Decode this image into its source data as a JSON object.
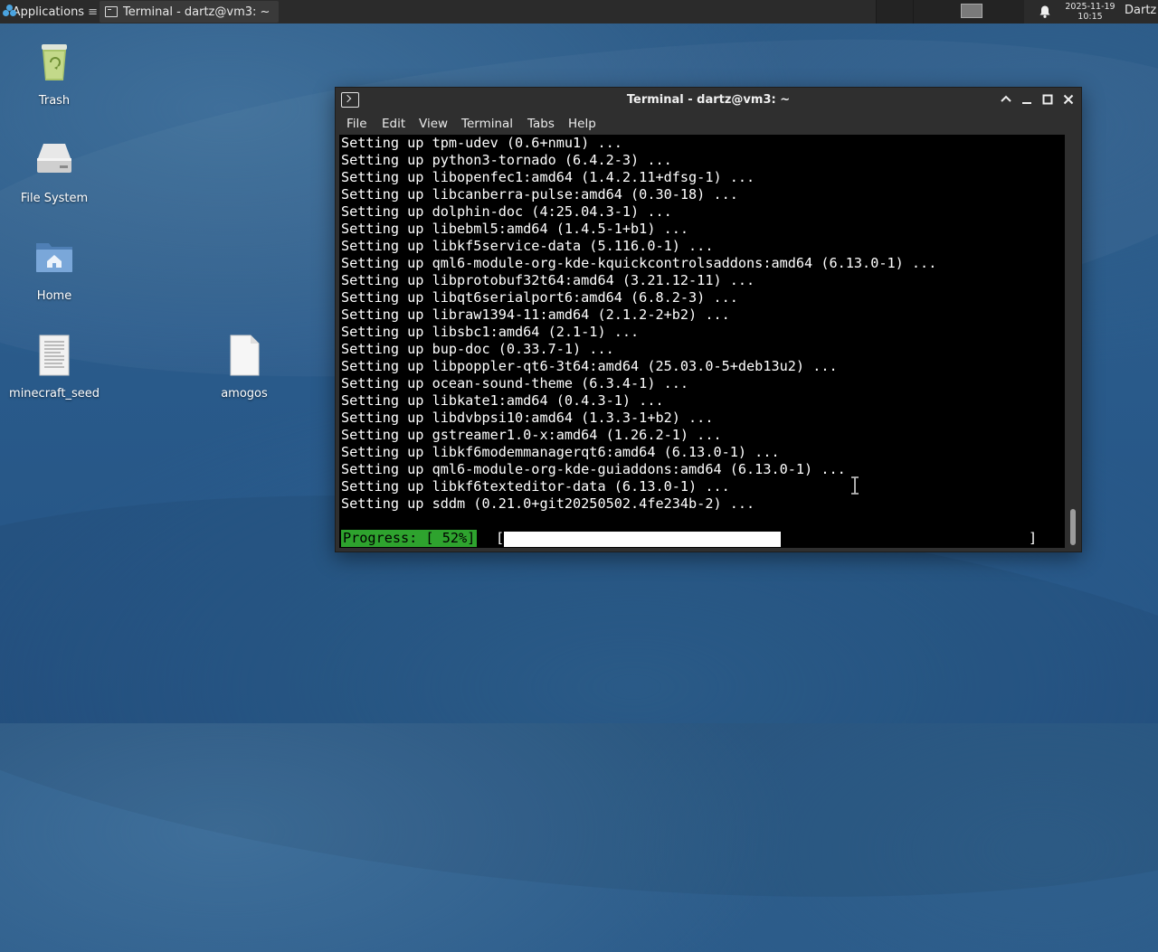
{
  "panel": {
    "apps_label": "Applications",
    "task_title": "Terminal - dartz@vm3: ~",
    "clock_date": "2025-11-19",
    "clock_time": "10:15",
    "user": "Dartz"
  },
  "desktop": {
    "icons": [
      {
        "label": "Trash",
        "icon": "trash-icon"
      },
      {
        "label": "File System",
        "icon": "drive-icon"
      },
      {
        "label": "Home",
        "icon": "home-folder-icon"
      },
      {
        "label": "minecraft_seed",
        "icon": "text-file-icon"
      },
      {
        "label": "amogos",
        "icon": "blank-file-icon"
      }
    ]
  },
  "window": {
    "title": "Terminal - dartz@vm3: ~",
    "menu": [
      "File",
      "Edit",
      "View",
      "Terminal",
      "Tabs",
      "Help"
    ],
    "lines": [
      "Setting up tpm-udev (0.6+nmu1) ...",
      "Setting up python3-tornado (6.4.2-3) ...",
      "Setting up libopenfec1:amd64 (1.4.2.11+dfsg-1) ...",
      "Setting up libcanberra-pulse:amd64 (0.30-18) ...",
      "Setting up dolphin-doc (4:25.04.3-1) ...",
      "Setting up libebml5:amd64 (1.4.5-1+b1) ...",
      "Setting up libkf5service-data (5.116.0-1) ...",
      "Setting up qml6-module-org-kde-kquickcontrolsaddons:amd64 (6.13.0-1) ...",
      "Setting up libprotobuf32t64:amd64 (3.21.12-11) ...",
      "Setting up libqt6serialport6:amd64 (6.8.2-3) ...",
      "Setting up libraw1394-11:amd64 (2.1.2-2+b2) ...",
      "Setting up libsbc1:amd64 (2.1-1) ...",
      "Setting up bup-doc (0.33.7-1) ...",
      "Setting up libpoppler-qt6-3t64:amd64 (25.03.0-5+deb13u2) ...",
      "Setting up ocean-sound-theme (6.3.4-1) ...",
      "Setting up libkate1:amd64 (0.4.3-1) ...",
      "Setting up libdvbpsi10:amd64 (1.3.3-1+b2) ...",
      "Setting up gstreamer1.0-x:amd64 (1.26.2-1) ...",
      "Setting up libkf6modemmanagerqt6:amd64 (6.13.0-1) ...",
      "Setting up qml6-module-org-kde-guiaddons:amd64 (6.13.0-1) ...",
      "Setting up libkf6texteditor-data (6.13.0-1) ...",
      "Setting up sddm (0.21.0+git20250502.4fe234b-2) ..."
    ],
    "progress": {
      "label": "Progress: [ 52%]",
      "open": "[",
      "close": "]",
      "fraction": 0.52
    }
  },
  "colors": {
    "progress_label_bg": "#2ea32e",
    "terminal_bg": "#000000",
    "terminal_fg": "#ffffff"
  }
}
